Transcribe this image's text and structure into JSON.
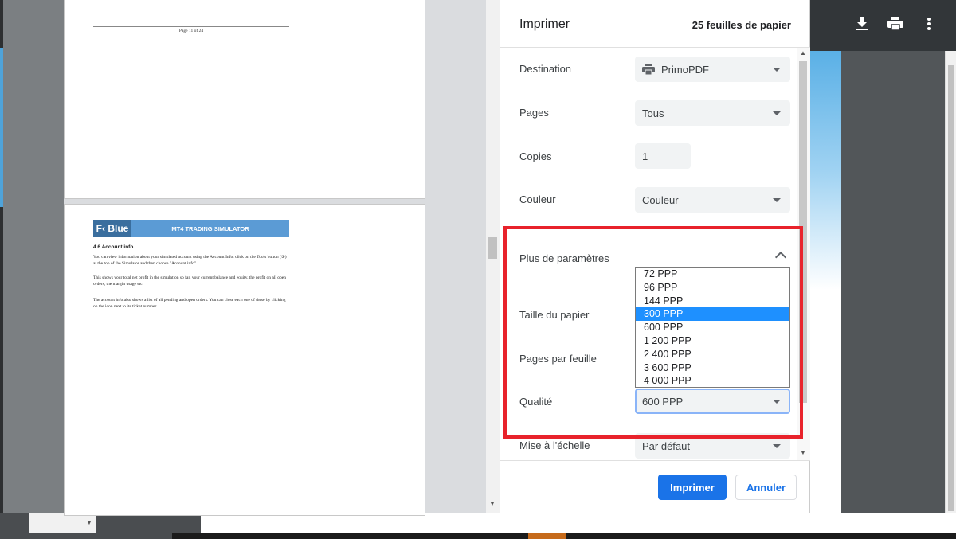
{
  "viewer": {
    "icons": [
      "download-icon",
      "print-icon",
      "more-vert-icon"
    ]
  },
  "preview": {
    "page1_footer": "Page 11 of 24",
    "page2": {
      "banner_logo": "F‹ Blue",
      "banner_title": "MT4 TRADING SIMULATOR",
      "heading": "4.6      Account info",
      "para1": "You can view information about your simulated account using the Account Info: click on the Tools button (①) at the top of the Simulator and then choose \"Account info\".",
      "para2": "This shows your total net profit in the simulation so far, your current balance and equity, the profit on all open orders, the margin usage etc.",
      "para3": "The account info also shows a list of all pending and open orders. You can close each one of these by clicking on the icon next to its ticket number."
    }
  },
  "dialog": {
    "title": "Imprimer",
    "sheets": "25 feuilles de papier",
    "settings": {
      "destination_label": "Destination",
      "destination_value": "PrimoPDF",
      "pages_label": "Pages",
      "pages_value": "Tous",
      "copies_label": "Copies",
      "copies_value": "1",
      "color_label": "Couleur",
      "color_value": "Couleur",
      "more_label": "Plus de paramètres",
      "paper_size_label": "Taille du papier",
      "pages_per_sheet_label": "Pages par feuille",
      "quality_label": "Qualité",
      "quality_value": "600 PPP",
      "scale_label": "Mise à l'échelle",
      "scale_value": "Par défaut"
    },
    "quality_options": [
      "72 PPP",
      "96 PPP",
      "144 PPP",
      "300 PPP",
      "600 PPP",
      "1 200 PPP",
      "2 400 PPP",
      "3 600 PPP",
      "4 000 PPP"
    ],
    "quality_highlighted": "300 PPP",
    "print_button": "Imprimer",
    "cancel_button": "Annuler"
  },
  "colors": {
    "accent": "#1a73e8",
    "highlight_box": "#e8222b",
    "dropdown_selected": "#1e90ff"
  }
}
